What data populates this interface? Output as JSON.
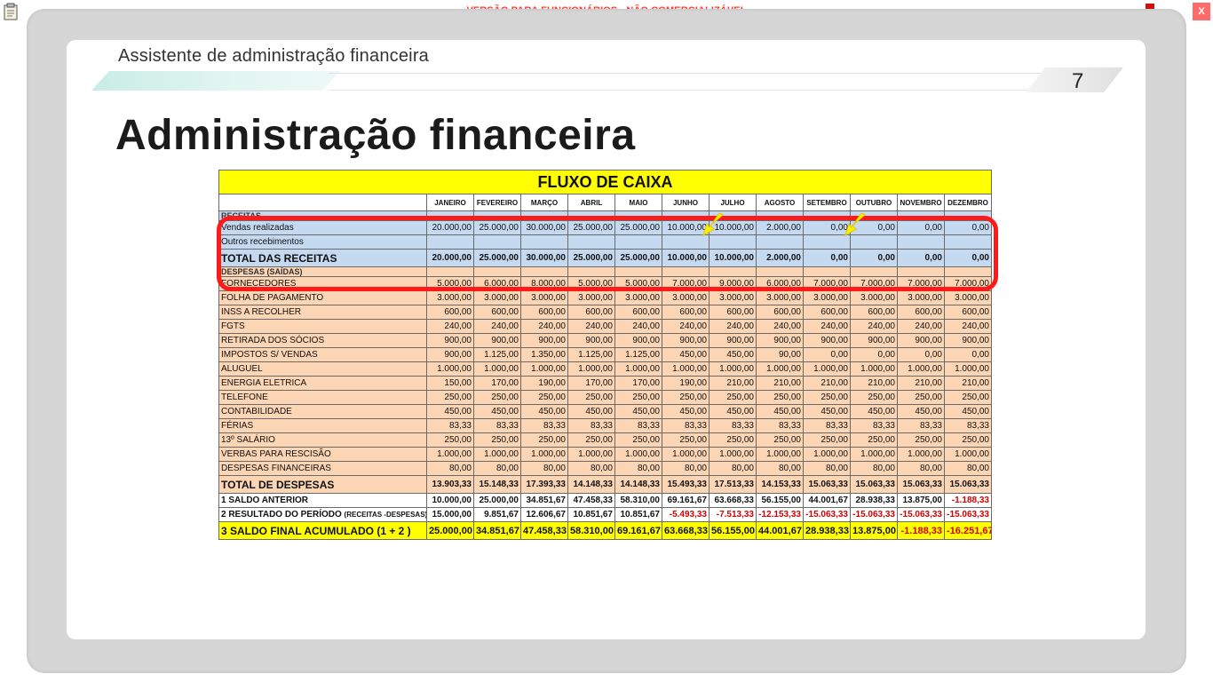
{
  "banner": {
    "text": "VERSÃO PARA FUNCIONÁRIOS - NÃO COMERCIALIZÁVEL"
  },
  "window": {
    "close_label": "X"
  },
  "header": {
    "course_title": "Assistente de administração financeira",
    "page_number": "7"
  },
  "slide": {
    "heading": "Administração financeira"
  },
  "table": {
    "title": "FLUXO DE CAIXA",
    "months": [
      "JANEIRO",
      "FEVEREIRO",
      "MARÇO",
      "ABRIL",
      "MAIO",
      "JUNHO",
      "JULHO",
      "AGOSTO",
      "SETEMBRO",
      "OUTUBRO",
      "NOVEMBRO",
      "DEZEMBRO"
    ],
    "receitas_section": "RECEITAS",
    "receitas": [
      {
        "label": "Vendas realizadas",
        "values": [
          "20.000,00",
          "25.000,00",
          "30.000,00",
          "25.000,00",
          "25.000,00",
          "10.000,00",
          "10.000,00",
          "2.000,00",
          "0,00",
          "0,00",
          "0,00",
          "0,00"
        ]
      },
      {
        "label": "Outros recebimentos",
        "values": [
          "",
          "",
          "",
          "",
          "",
          "",
          "",
          "",
          "",
          "",
          "",
          ""
        ]
      }
    ],
    "total_receitas": {
      "label": "TOTAL DAS RECEITAS",
      "values": [
        "20.000,00",
        "25.000,00",
        "30.000,00",
        "25.000,00",
        "25.000,00",
        "10.000,00",
        "10.000,00",
        "2.000,00",
        "0,00",
        "0,00",
        "0,00",
        "0,00"
      ]
    },
    "despesas_section": "DESPESAS (SAÍDAS)",
    "despesas": [
      {
        "label": "FORNECEDORES",
        "values": [
          "5.000,00",
          "6.000,00",
          "8.000,00",
          "5.000,00",
          "5.000,00",
          "7.000,00",
          "9.000,00",
          "6.000,00",
          "7.000,00",
          "7.000,00",
          "7.000,00",
          "7.000,00"
        ]
      },
      {
        "label": "FOLHA DE PAGAMENTO",
        "values": [
          "3.000,00",
          "3.000,00",
          "3.000,00",
          "3.000,00",
          "3.000,00",
          "3.000,00",
          "3.000,00",
          "3.000,00",
          "3.000,00",
          "3.000,00",
          "3.000,00",
          "3.000,00"
        ]
      },
      {
        "label": "INSS A RECOLHER",
        "values": [
          "600,00",
          "600,00",
          "600,00",
          "600,00",
          "600,00",
          "600,00",
          "600,00",
          "600,00",
          "600,00",
          "600,00",
          "600,00",
          "600,00"
        ]
      },
      {
        "label": "FGTS",
        "values": [
          "240,00",
          "240,00",
          "240,00",
          "240,00",
          "240,00",
          "240,00",
          "240,00",
          "240,00",
          "240,00",
          "240,00",
          "240,00",
          "240,00"
        ]
      },
      {
        "label": "RETIRADA DOS SÓCIOS",
        "values": [
          "900,00",
          "900,00",
          "900,00",
          "900,00",
          "900,00",
          "900,00",
          "900,00",
          "900,00",
          "900,00",
          "900,00",
          "900,00",
          "900,00"
        ]
      },
      {
        "label": "IMPOSTOS S/ VENDAS",
        "values": [
          "900,00",
          "1.125,00",
          "1.350,00",
          "1.125,00",
          "1.125,00",
          "450,00",
          "450,00",
          "90,00",
          "0,00",
          "0,00",
          "0,00",
          "0,00"
        ]
      },
      {
        "label": "ALUGUEL",
        "values": [
          "1.000,00",
          "1.000,00",
          "1.000,00",
          "1.000,00",
          "1.000,00",
          "1.000,00",
          "1.000,00",
          "1.000,00",
          "1.000,00",
          "1.000,00",
          "1.000,00",
          "1.000,00"
        ]
      },
      {
        "label": "ENERGIA ELETRICA",
        "values": [
          "150,00",
          "170,00",
          "190,00",
          "170,00",
          "170,00",
          "190,00",
          "210,00",
          "210,00",
          "210,00",
          "210,00",
          "210,00",
          "210,00"
        ]
      },
      {
        "label": "TELEFONE",
        "values": [
          "250,00",
          "250,00",
          "250,00",
          "250,00",
          "250,00",
          "250,00",
          "250,00",
          "250,00",
          "250,00",
          "250,00",
          "250,00",
          "250,00"
        ]
      },
      {
        "label": "CONTABILIDADE",
        "values": [
          "450,00",
          "450,00",
          "450,00",
          "450,00",
          "450,00",
          "450,00",
          "450,00",
          "450,00",
          "450,00",
          "450,00",
          "450,00",
          "450,00"
        ]
      },
      {
        "label": "FÉRIAS",
        "values": [
          "83,33",
          "83,33",
          "83,33",
          "83,33",
          "83,33",
          "83,33",
          "83,33",
          "83,33",
          "83,33",
          "83,33",
          "83,33",
          "83,33"
        ]
      },
      {
        "label": "13º SALÁRIO",
        "values": [
          "250,00",
          "250,00",
          "250,00",
          "250,00",
          "250,00",
          "250,00",
          "250,00",
          "250,00",
          "250,00",
          "250,00",
          "250,00",
          "250,00"
        ]
      },
      {
        "label": "VERBAS PARA RESCISÃO",
        "values": [
          "1.000,00",
          "1.000,00",
          "1.000,00",
          "1.000,00",
          "1.000,00",
          "1.000,00",
          "1.000,00",
          "1.000,00",
          "1.000,00",
          "1.000,00",
          "1.000,00",
          "1.000,00"
        ]
      },
      {
        "label": "DESPESAS FINANCEIRAS",
        "values": [
          "80,00",
          "80,00",
          "80,00",
          "80,00",
          "80,00",
          "80,00",
          "80,00",
          "80,00",
          "80,00",
          "80,00",
          "80,00",
          "80,00"
        ]
      }
    ],
    "total_despesas": {
      "label": "TOTAL DE DESPESAS",
      "values": [
        "13.903,33",
        "15.148,33",
        "17.393,33",
        "14.148,33",
        "14.148,33",
        "15.493,33",
        "17.513,33",
        "14.153,33",
        "15.063,33",
        "15.063,33",
        "15.063,33",
        "15.063,33"
      ]
    },
    "saldo_anterior": {
      "label": "1 SALDO ANTERIOR",
      "values": [
        "10.000,00",
        "25.000,00",
        "34.851,67",
        "47.458,33",
        "58.310,00",
        "69.161,67",
        "63.668,33",
        "56.155,00",
        "44.001,67",
        "28.938,33",
        "13.875,00",
        "-1.188,33"
      ]
    },
    "resultado": {
      "label": "2 RESULTADO DO PERÍODO",
      "label_suffix": "(RECEITAS -DESPESAS)",
      "values": [
        "15.000,00",
        "9.851,67",
        "12.606,67",
        "10.851,67",
        "10.851,67",
        "-5.493,33",
        "-7.513,33",
        "-12.153,33",
        "-15.063,33",
        "-15.063,33",
        "-15.063,33",
        "-15.063,33"
      ]
    },
    "saldo_final": {
      "label": "3 SALDO FINAL ACUMULADO (1 + 2 )",
      "values": [
        "25.000,00",
        "34.851,67",
        "47.458,33",
        "58.310,00",
        "69.161,67",
        "63.668,33",
        "56.155,00",
        "44.001,67",
        "28.938,33",
        "13.875,00",
        "-1.188,33",
        "-16.251,67"
      ]
    }
  },
  "colors": {
    "banner_text": "#ff3b30",
    "table_title_bg": "#ffff00",
    "receitas_bg": "#c5d9f1",
    "despesas_bg": "#fcd5b4",
    "negative": "#d40000",
    "highlight_border": "#ff1a1a",
    "arrow": "#ffee00"
  },
  "icons": {
    "clipboard": "clipboard-icon",
    "network": "network-status-icon",
    "close": "close-icon",
    "arrow": "yellow-arrow-icon"
  }
}
